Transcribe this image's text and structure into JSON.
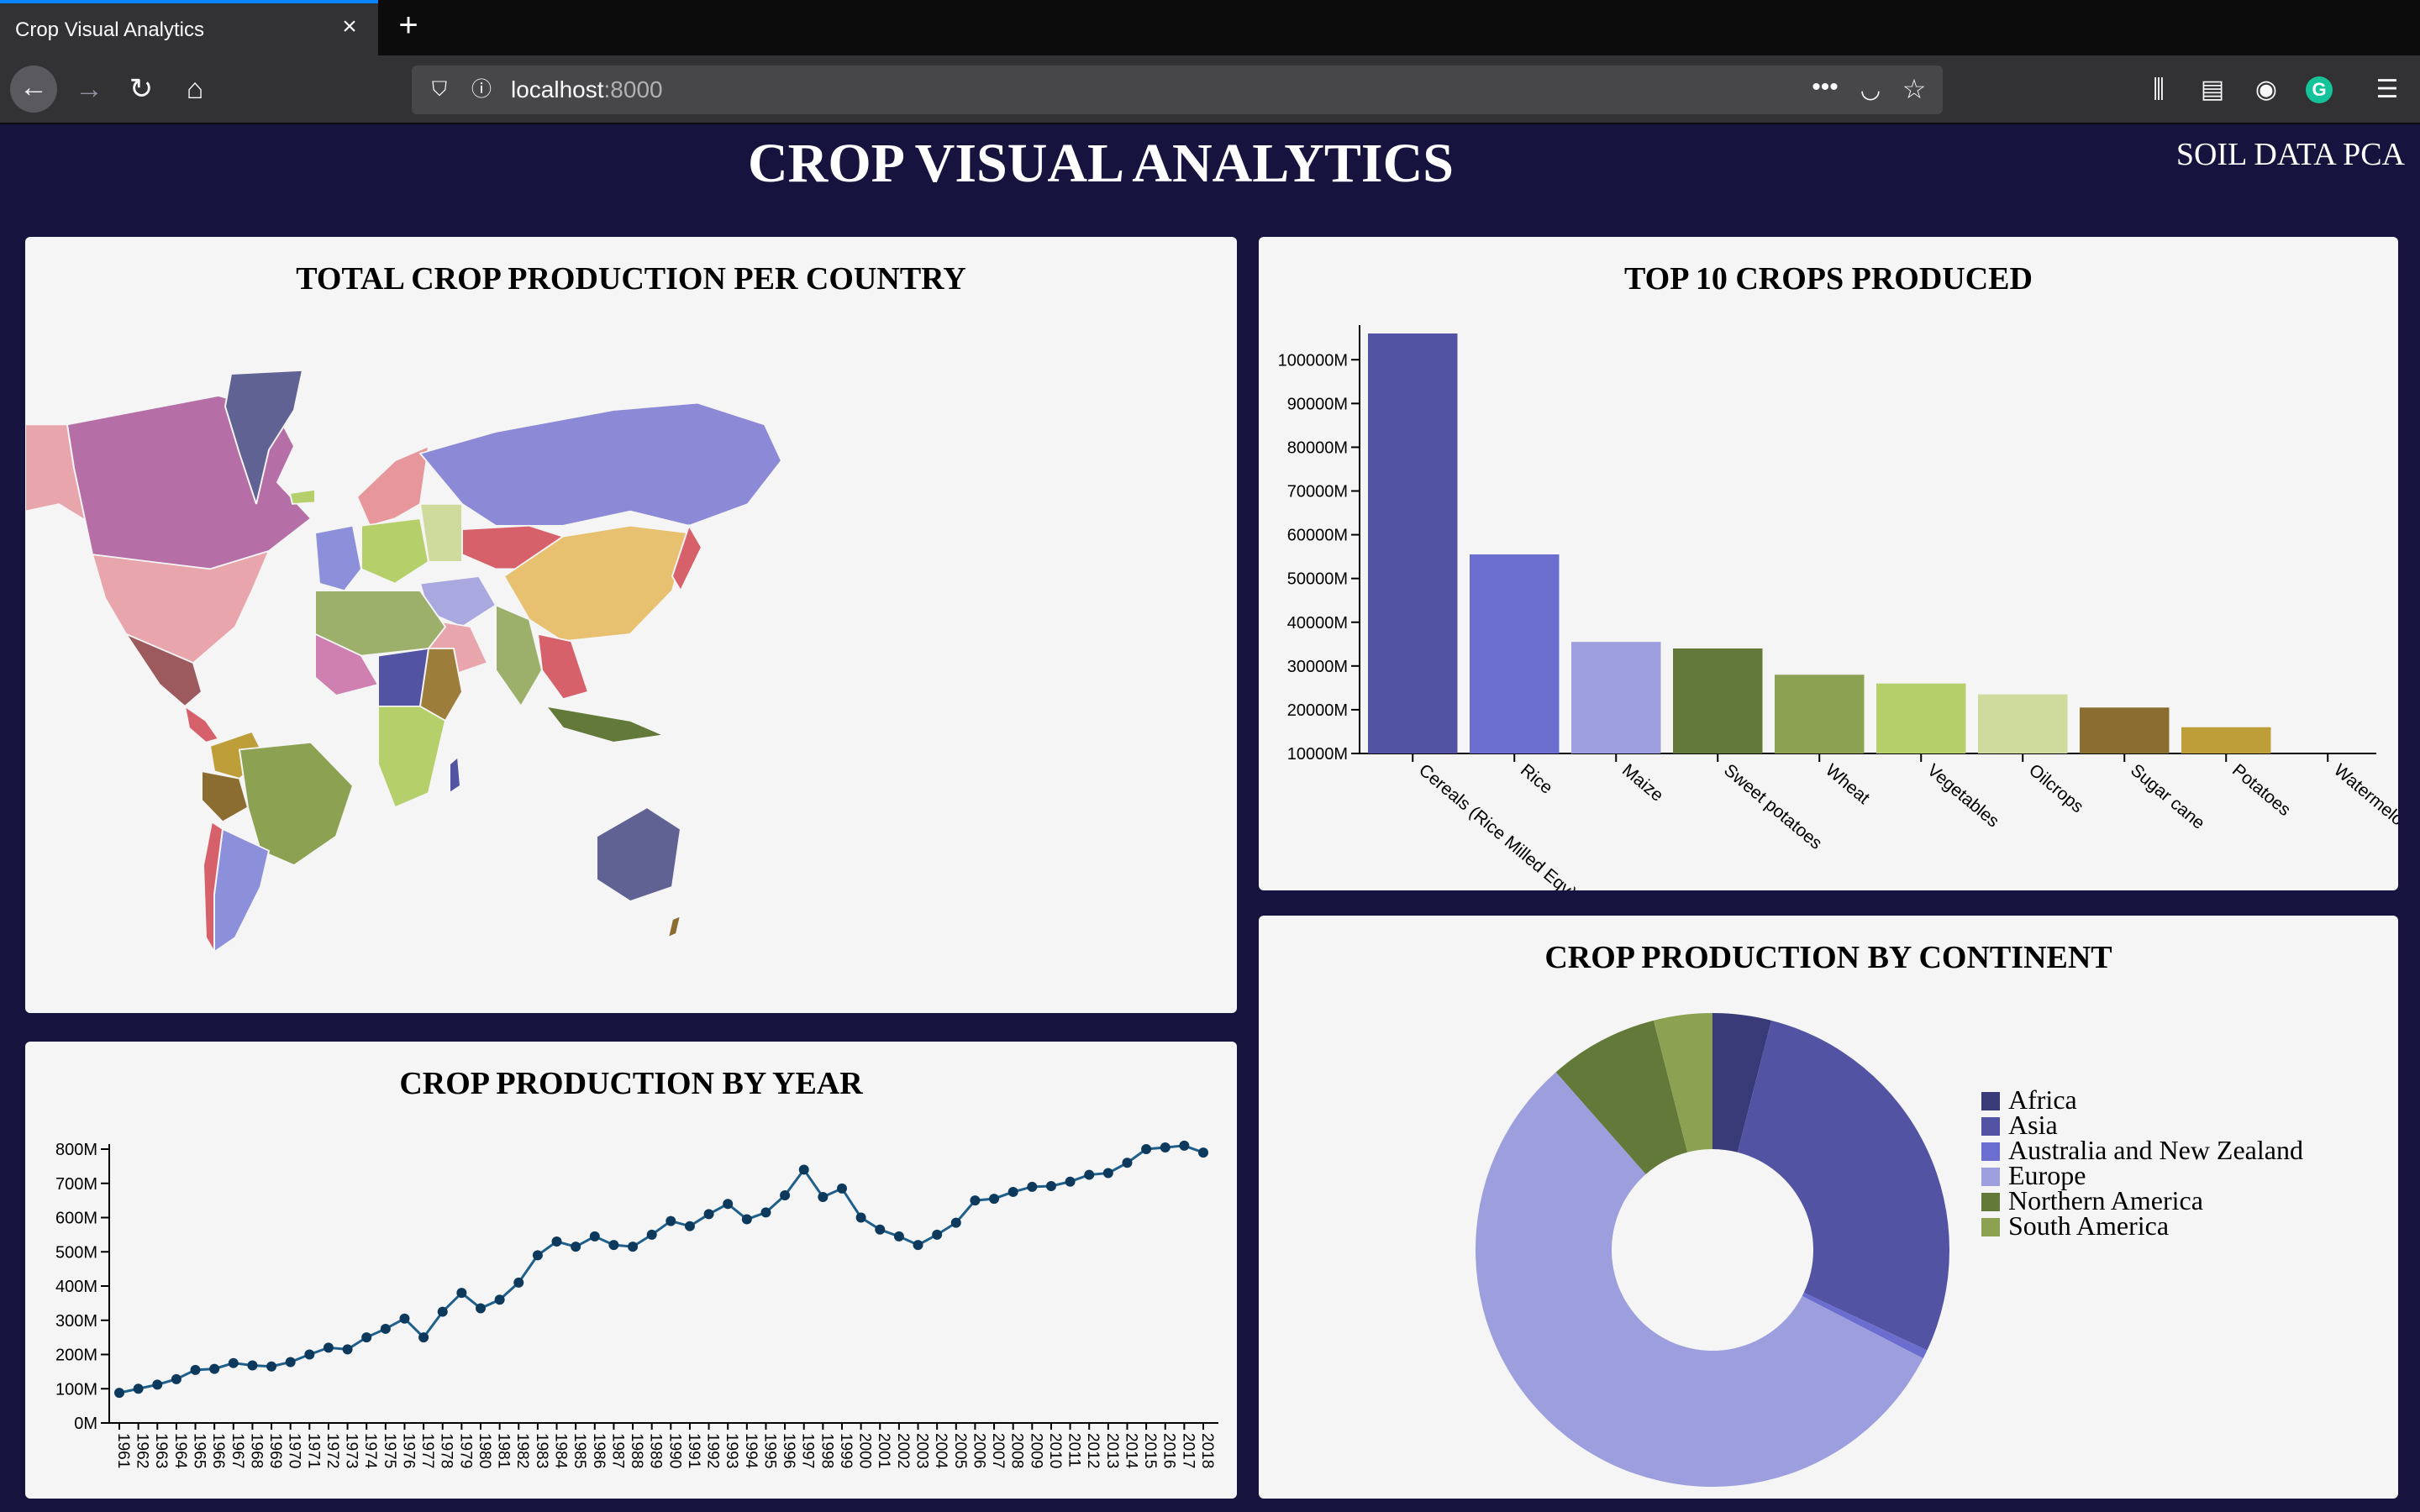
{
  "browser": {
    "tab_title": "Crop Visual Analytics",
    "url_host": "localhost",
    "url_port": ":8000",
    "icons": [
      "back-arrow-icon",
      "forward-arrow-icon",
      "reload-icon",
      "home-icon",
      "shield-icon",
      "info-icon",
      "more-icon",
      "pocket-icon",
      "star-icon",
      "library-icon",
      "sidebar-icon",
      "account-icon",
      "grammarly-icon",
      "menu-icon"
    ]
  },
  "header": {
    "title": "CROP VISUAL ANALYTICS",
    "soil_link": "SOIL DATA PCA"
  },
  "map_panel": {
    "title": "TOTAL CROP PRODUCTION PER COUNTRY"
  },
  "top_crops_panel": {
    "title": "TOP 10 CROPS PRODUCED"
  },
  "year_panel": {
    "title": "CROP PRODUCTION BY YEAR"
  },
  "continent_panel": {
    "title": "CROP PRODUCTION BY CONTINENT"
  },
  "chart_data": [
    {
      "type": "bar",
      "title": "TOP 10 CROPS PRODUCED",
      "categories": [
        "Cereals (Rice Milled Eqv)",
        "Rice",
        "Maize",
        "Sweet potatoes",
        "Wheat",
        "Vegetables",
        "Oilcrops",
        "Sugar cane",
        "Potatoes",
        "Watermelons"
      ],
      "values": [
        106000,
        55500,
        35500,
        34000,
        28000,
        26000,
        23500,
        20500,
        16000,
        10000
      ],
      "colors": [
        "#5254a3",
        "#6b6ecf",
        "#9c9ede",
        "#637939",
        "#8ca252",
        "#b5cf6b",
        "#cedb9c",
        "#8c6d31",
        "#bd9e39",
        "#e7ba52"
      ],
      "ylim": [
        10000,
        106000
      ],
      "yticks": [
        10000,
        20000,
        30000,
        40000,
        50000,
        60000,
        70000,
        80000,
        90000,
        100000
      ],
      "ytick_suffix": "M",
      "grid": false
    },
    {
      "type": "line",
      "title": "CROP PRODUCTION BY YEAR",
      "x": [
        1961,
        1962,
        1963,
        1964,
        1965,
        1966,
        1967,
        1968,
        1969,
        1970,
        1971,
        1972,
        1973,
        1974,
        1975,
        1976,
        1977,
        1978,
        1979,
        1980,
        1981,
        1982,
        1983,
        1984,
        1985,
        1986,
        1987,
        1988,
        1989,
        1990,
        1991,
        1992,
        1993,
        1994,
        1995,
        1996,
        1997,
        1998,
        1999,
        2000,
        2001,
        2002,
        2003,
        2004,
        2005,
        2006,
        2007,
        2008,
        2009,
        2010,
        2011,
        2012,
        2013,
        2014,
        2015,
        2016,
        2017,
        2018
      ],
      "xticks": [
        1961,
        1962,
        1963,
        1964,
        1965,
        1966,
        1967,
        1968,
        1969,
        1970,
        1971,
        1972,
        1973,
        1974,
        1975,
        1976,
        1977,
        1978,
        1979,
        1980,
        1981,
        1982,
        1983,
        1984,
        1985,
        1986,
        1987,
        1988,
        1989,
        1990,
        1991,
        1992,
        1993,
        1994,
        1995,
        1996,
        1997,
        1998,
        1999,
        2000,
        2001,
        2002,
        2003,
        2004,
        2005,
        2006,
        2007,
        2008,
        2009,
        2010,
        2011,
        2012,
        2013,
        2014,
        2015,
        2016,
        2017,
        2018
      ],
      "values": [
        88,
        100,
        112,
        128,
        155,
        158,
        175,
        168,
        165,
        178,
        200,
        220,
        215,
        250,
        275,
        305,
        250,
        325,
        380,
        335,
        360,
        410,
        490,
        530,
        515,
        545,
        520,
        515,
        550,
        590,
        575,
        610,
        640,
        595,
        615,
        665,
        740,
        660,
        685,
        600,
        565,
        545,
        520,
        550,
        585,
        650,
        655,
        675,
        690,
        692,
        705,
        725,
        730,
        760,
        800,
        805,
        810,
        790
      ],
      "ylim": [
        0,
        800
      ],
      "yticks": [
        0,
        100,
        200,
        300,
        400,
        500,
        600,
        700,
        800
      ],
      "ytick_suffix": "M",
      "color": "#1f5f8b",
      "grid": false
    },
    {
      "type": "pie",
      "title": "CROP PRODUCTION BY CONTINENT",
      "donut": true,
      "slices": [
        {
          "label": "Africa",
          "value": 4.0,
          "color": "#393b79"
        },
        {
          "label": "Asia",
          "value": 28.0,
          "color": "#5254a3"
        },
        {
          "label": "Australia and New Zealand",
          "value": 0.6,
          "color": "#6b6ecf"
        },
        {
          "label": "Europe",
          "value": 56.0,
          "color": "#9c9ede"
        },
        {
          "label": "Northern America",
          "value": 7.5,
          "color": "#637939"
        },
        {
          "label": "South America",
          "value": 4.0,
          "color": "#8ca252"
        }
      ],
      "legend_position": "right"
    }
  ]
}
